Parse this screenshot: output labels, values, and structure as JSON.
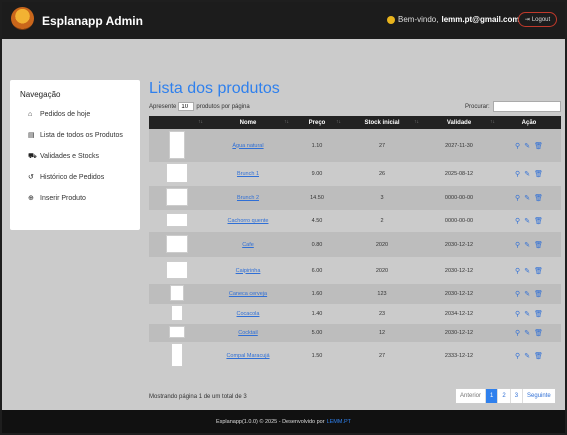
{
  "navbar": {
    "brand": "Esplanapp Admin",
    "welcome_prefix": "Bem-vindo,",
    "email": "lemm.pt@gmail.com",
    "logout": "Logout"
  },
  "sidebar": {
    "title": "Navegação",
    "items": [
      {
        "label": "Pedidos de hoje",
        "icon": "home-icon"
      },
      {
        "label": "Lista de todos os Produtos",
        "icon": "boxes-icon"
      },
      {
        "label": "Validades e Stocks",
        "icon": "truck-icon"
      },
      {
        "label": "Histórico de Pedidos",
        "icon": "history-icon"
      },
      {
        "label": "Inserir Produto",
        "icon": "plus-circle-icon"
      }
    ]
  },
  "main": {
    "title": "Lista dos produtos",
    "length_prefix": "Apresente",
    "length_value": "10",
    "length_suffix": "produtos por página",
    "search_label": "Procurar:"
  },
  "table": {
    "columns": [
      "",
      "Nome",
      "Preço",
      "Stock inicial",
      "Validade",
      "Ação"
    ],
    "rows": [
      {
        "name": "Água natural",
        "price": "1.10",
        "stock": "27",
        "validity": "2027-11-30"
      },
      {
        "name": "Brunch 1",
        "price": "9.00",
        "stock": "26",
        "validity": "2025-08-12"
      },
      {
        "name": "Brunch 2",
        "price": "14.50",
        "stock": "3",
        "validity": "0000-00-00"
      },
      {
        "name": "Cachorro quente",
        "price": "4.50",
        "stock": "2",
        "validity": "0000-00-00"
      },
      {
        "name": "Cafe",
        "price": "0.80",
        "stock": "2020",
        "validity": "2030-12-12"
      },
      {
        "name": "Caipirinha",
        "price": "6.00",
        "stock": "2020",
        "validity": "2030-12-12"
      },
      {
        "name": "Caneca cerveja",
        "price": "1.60",
        "stock": "123",
        "validity": "2030-12-12"
      },
      {
        "name": "Cocacola",
        "price": "1.40",
        "stock": "23",
        "validity": "2034-12-12"
      },
      {
        "name": "Cocktail",
        "price": "5.00",
        "stock": "12",
        "validity": "2030-12-12"
      },
      {
        "name": "Compal Maracujá",
        "price": "1.50",
        "stock": "27",
        "validity": "2333-12-12"
      }
    ]
  },
  "info": "Mostrando página 1 de um total de 3",
  "pagination": {
    "prev": "Anterior",
    "pages": [
      "1",
      "2",
      "3"
    ],
    "next": "Seguinte"
  },
  "footer": {
    "text": "Esplanapp(1.0.0) © 2025 - Desenvolvido por",
    "link": "LEMM.PT"
  },
  "colors": {
    "accent": "#2f80ed",
    "navbar": "#1c1c1c"
  }
}
